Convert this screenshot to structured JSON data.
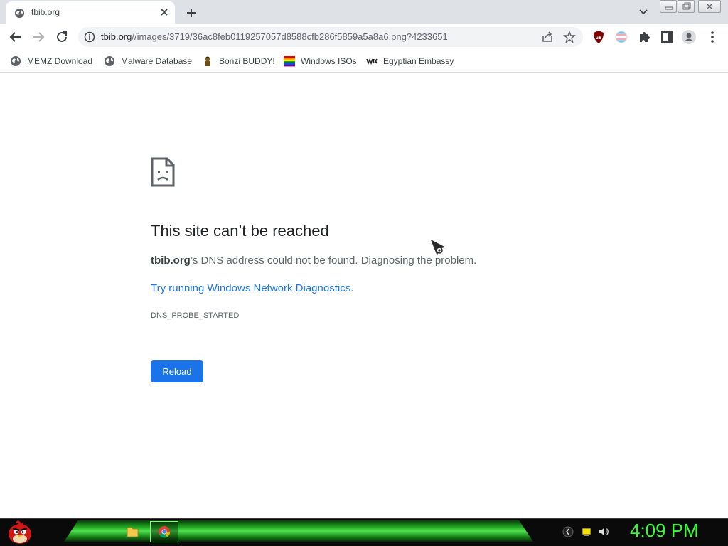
{
  "tab": {
    "title": "tbib.org"
  },
  "address_bar": {
    "host": "tbib.org",
    "path": "//images/3719/36ac8feb0119257057d8588cfb286f5859a5a8a6.png?4233651"
  },
  "bookmarks": [
    {
      "label": "MEMZ Download",
      "icon": "globe-icon"
    },
    {
      "label": "Malware Database",
      "icon": "globe-icon"
    },
    {
      "label": "Bonzi BUDDY!",
      "icon": "bonzi-icon"
    },
    {
      "label": "Windows ISOs",
      "icon": "rainbow-flag-icon"
    },
    {
      "label": "Egyptian Embassy",
      "icon": "wix-icon"
    }
  ],
  "error": {
    "headline": "This site can’t be reached",
    "host": "tbib.org",
    "summary_rest": "’s DNS address could not be found. Diagnosing the problem.",
    "suggestion_link": "Try running Windows Network Diagnostics",
    "suggestion_end": ".",
    "code": "DNS_PROBE_STARTED",
    "reload_label": "Reload"
  },
  "taskbar": {
    "clock": "4:09 PM"
  },
  "colors": {
    "accent": "#1a73e8",
    "clock": "#33ff33",
    "taskbar_glow": "#4fe04f"
  }
}
